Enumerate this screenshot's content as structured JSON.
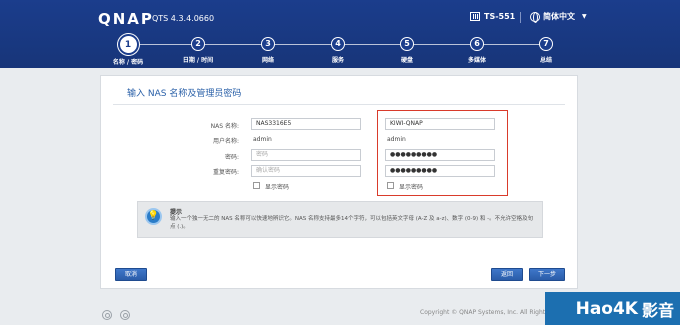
{
  "header": {
    "logo": "QNAP",
    "version": "QTS 4.3.4.0660",
    "model": "TS-551",
    "language": "简体中文"
  },
  "steps": [
    {
      "number": "1",
      "label": "名称 / 密码",
      "active": true
    },
    {
      "number": "2",
      "label": "日期 / 时间",
      "active": false
    },
    {
      "number": "3",
      "label": "网络",
      "active": false
    },
    {
      "number": "4",
      "label": "服务",
      "active": false
    },
    {
      "number": "5",
      "label": "硬盘",
      "active": false
    },
    {
      "number": "6",
      "label": "多媒体",
      "active": false
    },
    {
      "number": "7",
      "label": "总结",
      "active": false
    }
  ],
  "card": {
    "title": "输入 NAS 名称及管理员密码",
    "labels": {
      "nas_name": "NAS 名称:",
      "username": "用户名称:",
      "password": "密码:",
      "confirm_password": "重复密码:"
    },
    "left": {
      "nas_name_value": "NAS3316E5",
      "username_value": "admin",
      "password_placeholder": "密码",
      "confirm_placeholder": "确认密码",
      "show_password_label": "显示密码"
    },
    "right": {
      "nas_name_value": "KIWI-QNAP",
      "username_value": "admin",
      "password_value": "●●●●●●●●●",
      "confirm_value": "●●●●●●●●●",
      "show_password_label": "显示密码"
    },
    "tip": {
      "title": "提示",
      "text": "输入一个独一无二的 NAS 名称可以快速地辨识它。NAS 名称支持最多14个字符，可以包括英文字母 (A-Z 及 a-z)、数字 (0-9) 和 -。不允许空格及句点 (.)。"
    },
    "buttons": {
      "cancel": "取消",
      "back": "返回",
      "next": "下一步"
    }
  },
  "footer": {
    "copyright": "Copyright © QNAP Systems, Inc. All Rights Reserved."
  },
  "watermark": {
    "main": "Hao4K",
    "side": "影音"
  },
  "colors": {
    "header_bg": "#1b3d8c",
    "accent": "#2a60a8",
    "highlight_border": "#d93b2b",
    "button": "#2a5ca8"
  }
}
